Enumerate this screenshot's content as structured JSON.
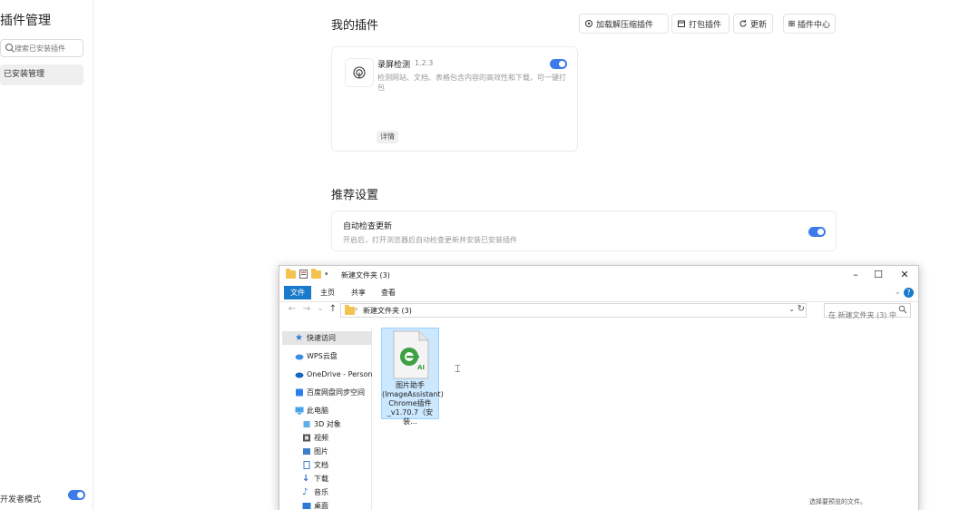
{
  "app": {
    "title": "插件管理",
    "search_placeholder": "搜索已安装插件",
    "nav_item": "已安装管理",
    "dev_mode_label": "开发者模式"
  },
  "my_plugins": {
    "title": "我的插件",
    "buttons": {
      "load_unpacked": "加载解压缩插件",
      "pack": "打包插件",
      "update": "更新",
      "center": "插件中心"
    },
    "card": {
      "name": "录屏检测",
      "version": "1.2.3",
      "description": "检测网站、文档、表格包含内容的高效性和下载，可一键打包",
      "tag": "详情"
    }
  },
  "recommend": {
    "title": "推荐设置",
    "setting_title": "自动检查更新",
    "setting_desc": "开启后，打开浏览器后自动检查更新并安装已安装插件"
  },
  "explorer": {
    "window_title": "新建文件夹 (3)",
    "ribbon_tabs": [
      "文件",
      "主页",
      "共享",
      "查看"
    ],
    "breadcrumb": "新建文件夹 (3)",
    "search_placeholder": "在 新建文件夹 (3) 中...",
    "tree": [
      "快速访问",
      "WPS云盘",
      "OneDrive - Personal",
      "百度网盘同步空间",
      "此电脑",
      "3D 对象",
      "视频",
      "图片",
      "文档",
      "下载",
      "音乐",
      "桌面"
    ],
    "file_name": "图片助手(ImageAssistant) Chrome插件_v1.70.7（安装...",
    "file_badge": "AI",
    "empty_hint": "选择要预览的文件。"
  }
}
